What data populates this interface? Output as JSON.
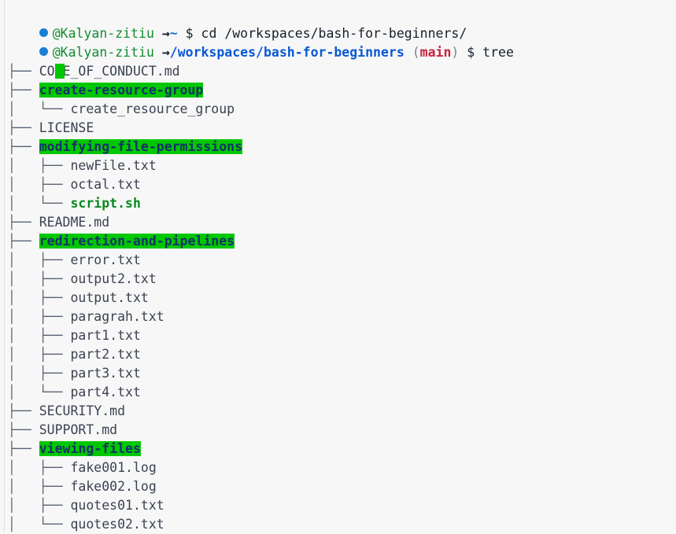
{
  "terminal": {
    "background_color": "#f7f7f7",
    "default_text_color": "#3b4252",
    "dir_highlight_color": "#00c800",
    "dir_text_color": "#16306b",
    "exe_text_color": "#0a8a21",
    "prompt_user_color": "#128c2e",
    "prompt_path_color": "#0a58d6",
    "prompt_branch_color": "#c9233f",
    "bullet_color": "#1a7fd4",
    "cursor_color": "#00c800"
  },
  "prompt_lines": [
    {
      "bullet": "status-dot",
      "user": "@Kalyan-zitiu",
      "arrow": "→",
      "location": "~",
      "branch": null,
      "sigil": "$",
      "command": "cd /workspaces/bash-for-beginners/"
    },
    {
      "bullet": "status-dot",
      "user": "@Kalyan-zitiu",
      "arrow": "→",
      "location": "/workspaces/bash-for-beginners",
      "branch": "main",
      "sigil": "$",
      "command": "tree"
    }
  ],
  "paren_open": "(",
  "paren_close": ")",
  "tree": [
    {
      "prefix": "├── ",
      "name": "CODE_OF_CONDUCT.md",
      "kind": "file"
    },
    {
      "prefix": "├── ",
      "name": "create-resource-group",
      "kind": "dir"
    },
    {
      "prefix": "│   └── ",
      "name": "create_resource_group",
      "kind": "file"
    },
    {
      "prefix": "├── ",
      "name": "LICENSE",
      "kind": "file"
    },
    {
      "prefix": "├── ",
      "name": "modifying-file-permissions",
      "kind": "dir"
    },
    {
      "prefix": "│   ├── ",
      "name": "newFile.txt",
      "kind": "file"
    },
    {
      "prefix": "│   ├── ",
      "name": "octal.txt",
      "kind": "file"
    },
    {
      "prefix": "│   └── ",
      "name": "script.sh",
      "kind": "exe"
    },
    {
      "prefix": "├── ",
      "name": "README.md",
      "kind": "file"
    },
    {
      "prefix": "├── ",
      "name": "redirection-and-pipelines",
      "kind": "dir"
    },
    {
      "prefix": "│   ├── ",
      "name": "error.txt",
      "kind": "file"
    },
    {
      "prefix": "│   ├── ",
      "name": "output2.txt",
      "kind": "file"
    },
    {
      "prefix": "│   ├── ",
      "name": "output.txt",
      "kind": "file"
    },
    {
      "prefix": "│   ├── ",
      "name": "paragrah.txt",
      "kind": "file"
    },
    {
      "prefix": "│   ├── ",
      "name": "part1.txt",
      "kind": "file"
    },
    {
      "prefix": "│   ├── ",
      "name": "part2.txt",
      "kind": "file"
    },
    {
      "prefix": "│   ├── ",
      "name": "part3.txt",
      "kind": "file"
    },
    {
      "prefix": "│   └── ",
      "name": "part4.txt",
      "kind": "file"
    },
    {
      "prefix": "├── ",
      "name": "SECURITY.md",
      "kind": "file"
    },
    {
      "prefix": "├── ",
      "name": "SUPPORT.md",
      "kind": "file"
    },
    {
      "prefix": "├── ",
      "name": "viewing-files",
      "kind": "dir"
    },
    {
      "prefix": "│   ├── ",
      "name": "fake001.log",
      "kind": "file"
    },
    {
      "prefix": "│   ├── ",
      "name": "fake002.log",
      "kind": "file"
    },
    {
      "prefix": "│   ├── ",
      "name": "quotes01.txt",
      "kind": "file"
    },
    {
      "prefix": "│   └── ",
      "name": "quotes02.txt",
      "kind": "file"
    }
  ]
}
